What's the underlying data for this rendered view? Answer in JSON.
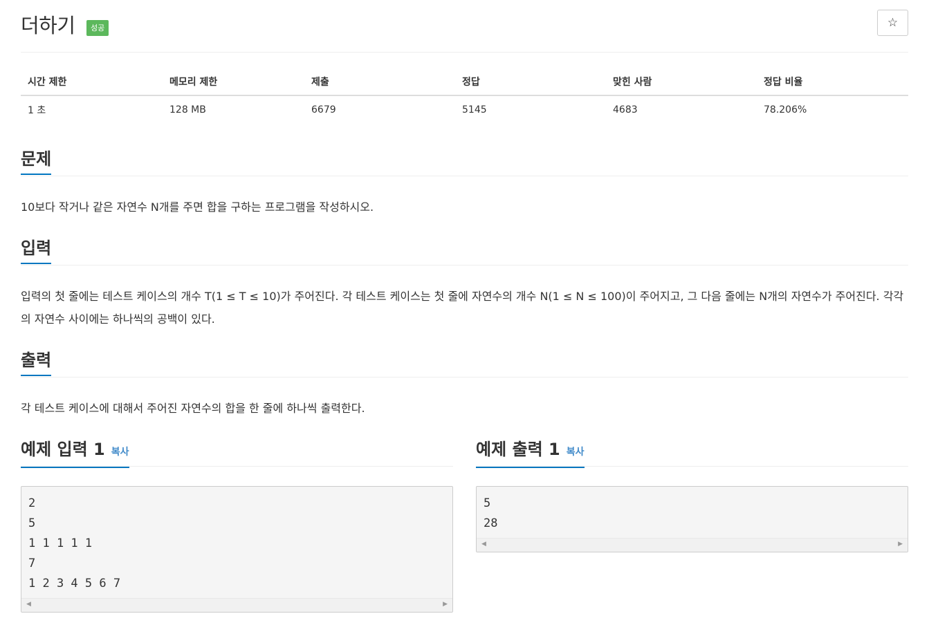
{
  "problem": {
    "title": "더하기",
    "badge": "성공",
    "star_icon": "☆"
  },
  "info_table": {
    "headers": [
      "시간 제한",
      "메모리 제한",
      "제출",
      "정답",
      "맞힌 사람",
      "정답 비율"
    ],
    "values": [
      "1 초",
      "128 MB",
      "6679",
      "5145",
      "4683",
      "78.206%"
    ]
  },
  "sections": {
    "description": {
      "heading": "문제",
      "text": "10보다 작거나 같은 자연수 N개를 주면 합을 구하는 프로그램을 작성하시오."
    },
    "input": {
      "heading": "입력",
      "text": "입력의 첫 줄에는 테스트 케이스의 개수 T(1 ≤ T ≤ 10)가 주어진다. 각 테스트 케이스는 첫 줄에 자연수의 개수 N(1 ≤ N ≤ 100)이 주어지고, 그 다음 줄에는 N개의 자연수가 주어진다. 각각의 자연수 사이에는 하나씩의 공백이 있다."
    },
    "output": {
      "heading": "출력",
      "text": "각 테스트 케이스에 대해서 주어진 자연수의 합을 한 줄에 하나씩 출력한다."
    }
  },
  "samples": {
    "input": {
      "heading": "예제 입력 1",
      "copy_label": "복사",
      "content": "2\n5\n1 1 1 1 1\n7\n1 2 3 4 5 6 7"
    },
    "output": {
      "heading": "예제 출력 1",
      "copy_label": "복사",
      "content": "5\n28"
    }
  }
}
